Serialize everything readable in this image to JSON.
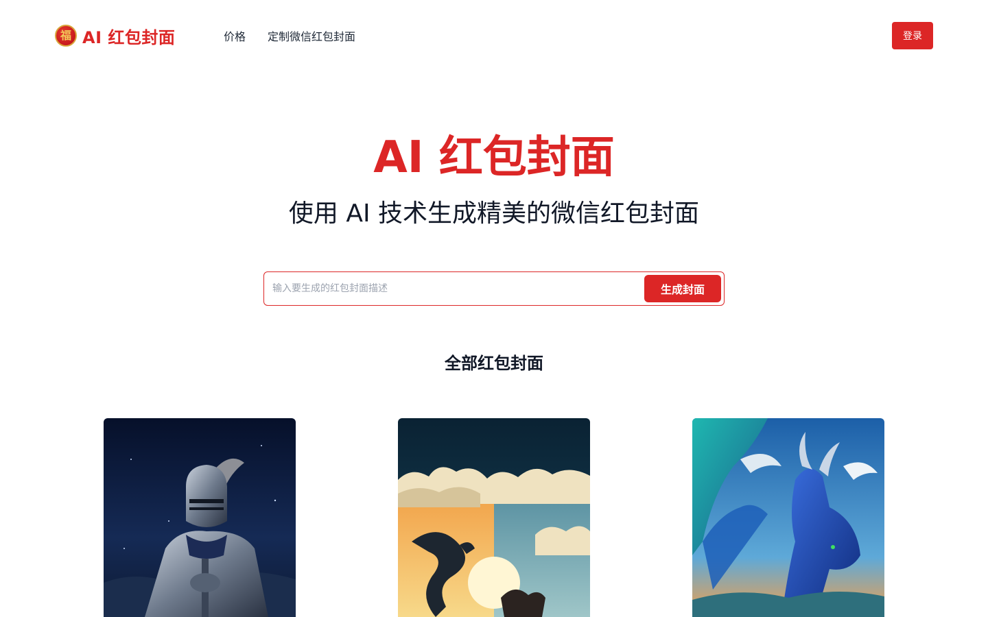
{
  "header": {
    "logo_icon": "fu-coin-icon",
    "logo_icon_char": "福",
    "logo_text": "AI 红包封面",
    "nav": {
      "pricing": "价格",
      "custom": "定制微信红包封面"
    },
    "login_label": "登录"
  },
  "hero": {
    "title": "AI 红包封面",
    "subtitle": "使用 AI 技术生成精美的微信红包封面"
  },
  "search": {
    "placeholder": "输入要生成的红包封面描述",
    "value": "",
    "button_label": "生成封面"
  },
  "gallery": {
    "title": "全部红包封面",
    "items": [
      {
        "subject": "armored-knight-night-sky",
        "alt": "knight"
      },
      {
        "subject": "dragon-and-horse-sunset-clouds",
        "alt": "dragon-horse"
      },
      {
        "subject": "blue-dragon-sky",
        "alt": "blue-dragon"
      }
    ]
  },
  "colors": {
    "accent": "#dc2626",
    "text": "#1f2937"
  }
}
